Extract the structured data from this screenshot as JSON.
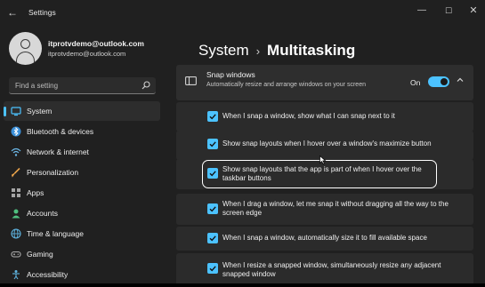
{
  "window": {
    "title": "Settings"
  },
  "account": {
    "name": "itprotvdemo@outlook.com",
    "email": "itprotvdemo@outlook.com"
  },
  "search": {
    "placeholder": "Find a setting"
  },
  "nav": {
    "items": [
      {
        "label": "System",
        "icon": "system-icon",
        "selected": true
      },
      {
        "label": "Bluetooth & devices",
        "icon": "bluetooth-icon"
      },
      {
        "label": "Network & internet",
        "icon": "wifi-icon"
      },
      {
        "label": "Personalization",
        "icon": "brush-icon"
      },
      {
        "label": "Apps",
        "icon": "apps-icon"
      },
      {
        "label": "Accounts",
        "icon": "person-icon"
      },
      {
        "label": "Time & language",
        "icon": "globe-icon"
      },
      {
        "label": "Gaming",
        "icon": "gamepad-icon"
      },
      {
        "label": "Accessibility",
        "icon": "accessibility-icon"
      }
    ]
  },
  "breadcrumb": {
    "parent": "System",
    "separator": "›",
    "current": "Multitasking"
  },
  "snap_windows": {
    "title": "Snap windows",
    "description": "Automatically resize and arrange windows on your screen",
    "toggle_state": "On",
    "enabled": true
  },
  "options": [
    {
      "label": "When I snap a window, show what I can snap next to it",
      "checked": true
    },
    {
      "label": "Show snap layouts when I hover over a window's maximize button",
      "checked": true
    },
    {
      "label": "Show snap layouts that the app is part of when I hover over the taskbar buttons",
      "checked": true
    },
    {
      "label": "When I drag a window, let me snap it without dragging all the way to the screen edge",
      "checked": true
    },
    {
      "label": "When I snap a window, automatically size it to fill available space",
      "checked": true
    },
    {
      "label": "When I resize a snapped window, simultaneously resize any adjacent snapped window",
      "checked": true
    }
  ],
  "colors": {
    "accent": "#4cc2ff",
    "window_bg": "#202020",
    "card_bg": "#2b2b2b"
  }
}
